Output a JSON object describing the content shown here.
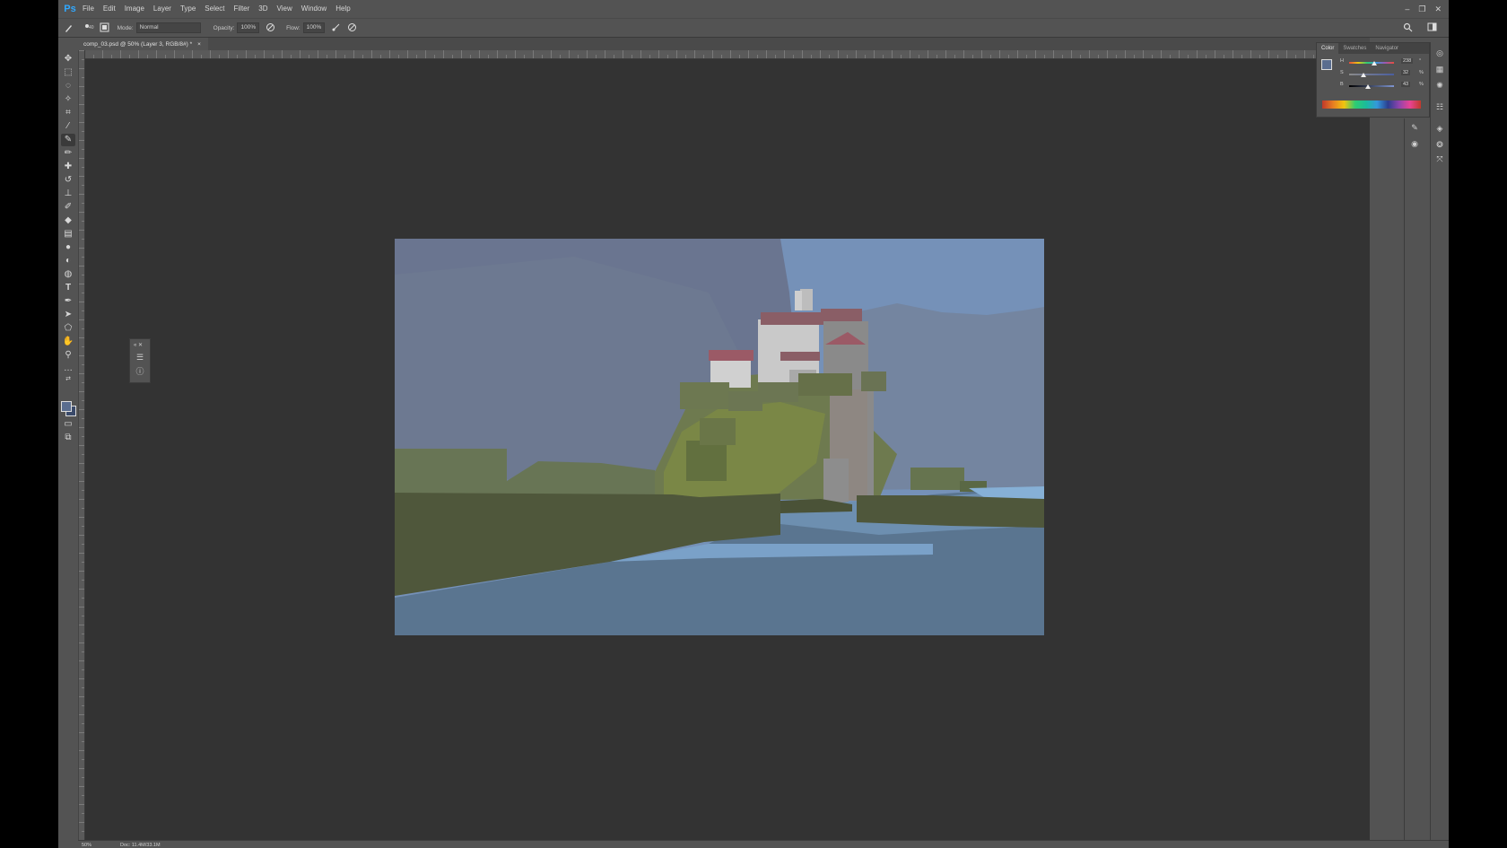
{
  "app": {
    "logo": "Ps"
  },
  "menu": [
    "File",
    "Edit",
    "Image",
    "Layer",
    "Type",
    "Select",
    "Filter",
    "3D",
    "View",
    "Window",
    "Help"
  ],
  "window_controls": {
    "minimize": "–",
    "restore": "❐",
    "close": "✕"
  },
  "options": {
    "mode_label": "Mode:",
    "mode_value": "Normal",
    "opacity_label": "Opacity:",
    "opacity_value": "100%",
    "flow_label": "Flow:",
    "flow_value": "100%",
    "brush_size": "40"
  },
  "document": {
    "tab_title": "comp_03.psd @ 50% (Layer 3, RGB/8#) *",
    "close_glyph": "×"
  },
  "tools": [
    "move-tool-icon",
    "marquee-tool-icon",
    "lasso-tool-icon",
    "magic-wand-icon",
    "crop-tool-icon",
    "eyedropper-icon",
    "brush-tool-icon",
    "pencil-icon",
    "healing-brush-icon",
    "history-brush-icon",
    "stamp-tool-icon",
    "art-history-icon",
    "eraser-icon",
    "gradient-icon",
    "blur-icon",
    "dodge-icon",
    "sponge-icon",
    "type-tool-icon",
    "pen-tool-icon",
    "path-select-icon",
    "shape-tool-icon",
    "hand-tool-icon",
    "zoom-tool-icon",
    "more-tools-icon"
  ],
  "color_panel": {
    "tabs": [
      "Color",
      "Swatches",
      "Navigator"
    ],
    "sliders": [
      {
        "label": "H",
        "value": "238",
        "unit": "°",
        "position": 0.55
      },
      {
        "label": "S",
        "value": "32",
        "unit": "%",
        "position": 0.32
      },
      {
        "label": "B",
        "value": "43",
        "unit": "%",
        "position": 0.43
      }
    ]
  },
  "colors": {
    "foreground": "#5a6d8f",
    "background": "#3a4a6a",
    "workspace": "#333333",
    "ui": "#535353"
  },
  "status": {
    "zoom": "50%",
    "doc_info": "Doc: 11.4M/33.1M"
  }
}
